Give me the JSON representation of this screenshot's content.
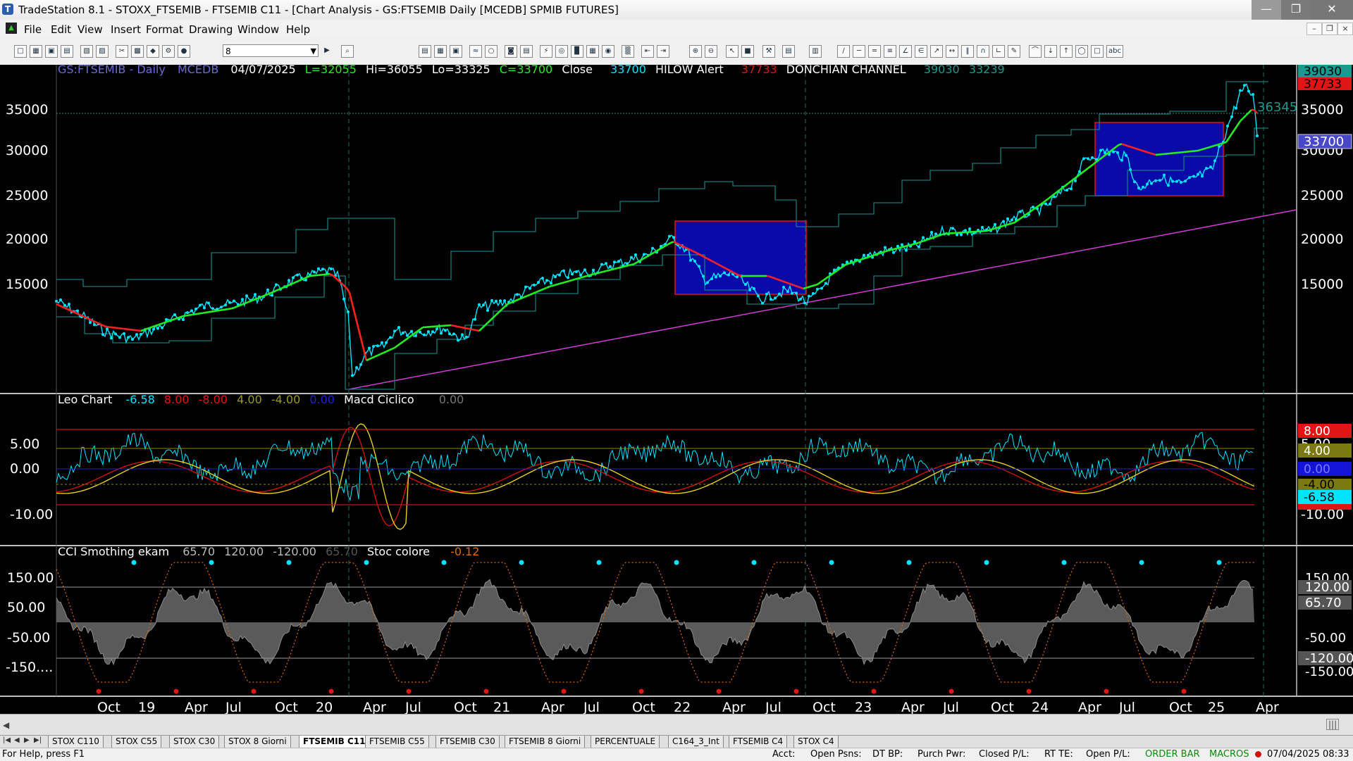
{
  "window": {
    "title": "TradeStation 8.1 - STOXX_FTSEMIB - FTSEMIB C11 - [Chart Analysis - GS:FTSEMIB  Daily  [MCEDB] SPMIB FUTURES]",
    "icons": [
      "minimize-icon",
      "maximize-icon",
      "close-icon"
    ]
  },
  "menu": {
    "items": [
      "File",
      "Edit",
      "View",
      "Insert",
      "Format",
      "Drawing",
      "Window",
      "Help"
    ]
  },
  "toolbar": {
    "combo_value": "8"
  },
  "chart": {
    "header": {
      "symbol": "GS:FTSEMIB - Daily",
      "source": "MCEDB",
      "date": "04/07/2025",
      "low_last": "L=32055",
      "hi": "Hi=36055",
      "lo": "Lo=33325",
      "close_val": "C=33700",
      "close_label": "Close",
      "close_num": "33700",
      "hilow": "HILOW Alert",
      "hilow_val": "37733",
      "donchian": "DONCHIAN CHANNEL",
      "don_hi": "39030",
      "don_lo": "33239"
    },
    "price_axis": [
      "35000",
      "30000",
      "25000",
      "20000",
      "15000"
    ],
    "price_tags": {
      "upper": "39030",
      "hilow": "37733",
      "last": "33700",
      "dashed": "36345",
      "axis_35000": "35000"
    },
    "osc": {
      "title": "Leo Chart",
      "vals": [
        "-6.58",
        "8.00",
        "-8.00",
        "4.00",
        "-4.00",
        "0.00"
      ],
      "macd": "Macd Ciclico",
      "macd_val": "0.00",
      "axis": [
        "5.00",
        "0.00",
        "-10.00"
      ],
      "tags": [
        "8.00",
        "4.00",
        "0.00",
        "-4.00",
        "-6.58",
        "-8.00"
      ]
    },
    "cci": {
      "title": "CCI Smothing ekam",
      "vals": [
        "65.70",
        "120.00",
        "-120.00",
        "65.70"
      ],
      "stoc": "Stoc colore",
      "stoc_val": "-0.12",
      "axis": [
        "150.00",
        "50.00",
        "-50.00",
        "-150...."
      ],
      "tags": [
        "150.00",
        "120.00",
        "65.70",
        "-50.00",
        "-120.00",
        "-150.00"
      ]
    },
    "time_axis": [
      "Oct",
      "19",
      "Apr",
      "Jul",
      "Oct",
      "20",
      "Apr",
      "Jul",
      "Oct",
      "21",
      "Apr",
      "Jul",
      "Oct",
      "22",
      "Apr",
      "Jul",
      "Oct",
      "23",
      "Apr",
      "Jul",
      "Oct",
      "24",
      "Apr",
      "Jul",
      "Oct",
      "25",
      "Apr"
    ],
    "colors": {
      "price": "#00e5ff",
      "ma_up": "#22ee22",
      "ma_down": "#ff2020",
      "trendline": "#d23cd2",
      "box": "#0a0aa8"
    }
  },
  "tabs": [
    "STOX C110",
    "STOX C55",
    "STOX  C30",
    "STOX  8 Giorni",
    "FTSEMIB C11",
    "FTSEMIB C55",
    "FTSEMIB C30",
    "FTSEMIB  8 Giorni",
    "PERCENTUALE",
    "C164_3_Int",
    "FTSEMIB C4",
    "STOX  C4"
  ],
  "active_tab": "FTSEMIB C11",
  "status": {
    "help": "For Help, press F1",
    "acct": "Acct:",
    "open_psns": "Open Psns:",
    "dt_bp": "DT BP:",
    "purch_pwr": "Purch Pwr:",
    "closed_pl": "Closed P/L:",
    "rt_te": "RT TE:",
    "open_pl": "Open P/L:",
    "order_bar": "ORDER BAR",
    "macros": "MACROS",
    "datetime": "07/04/2025 08:33"
  }
}
